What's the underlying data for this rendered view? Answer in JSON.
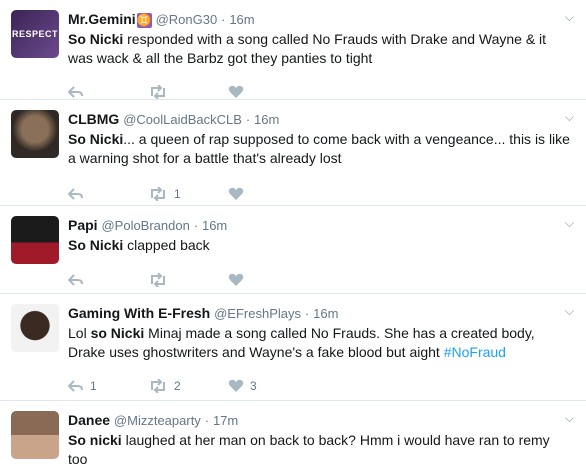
{
  "tweets": [
    {
      "name": "Mr.Gemini",
      "badge": "♊",
      "handle": "@RonG30",
      "time": "16m",
      "avatar_text": "RESPECT",
      "avatar_colors": [
        "#3a2455",
        "#6c4a8e"
      ],
      "text_bold": "So Nicki",
      "text_rest": " responded with a song called No Frauds with Drake and Wayne & it was wack & all the Barbz got they panties to tight",
      "hashtag": "",
      "reply_count": "",
      "retweet_count": "",
      "like_count": ""
    },
    {
      "name": "CLBMG",
      "badge": "",
      "handle": "@CoolLaidBackCLB",
      "time": "16m",
      "avatar_text": "",
      "avatar_colors": [
        "#6b5a47",
        "#2f2a25"
      ],
      "text_bold": "So Nicki",
      "text_rest": "... a queen of rap supposed to come back with a vengeance... this is like a warning shot for a battle that's already lost",
      "hashtag": "",
      "reply_count": "",
      "retweet_count": "1",
      "like_count": ""
    },
    {
      "name": "Papi",
      "badge": "",
      "handle": "@PoloBrandon",
      "time": "16m",
      "avatar_text": "",
      "avatar_colors": [
        "#1b1b1b",
        "#a01a2a"
      ],
      "text_bold": "So Nicki",
      "text_rest": " clapped back",
      "hashtag": "",
      "reply_count": "",
      "retweet_count": "",
      "like_count": ""
    },
    {
      "name": "Gaming With E-Fresh",
      "badge": "",
      "handle": "@EFreshPlays",
      "time": "16m",
      "avatar_text": "",
      "avatar_colors": [
        "#f2f2f2",
        "#3b2a22"
      ],
      "text_pre": "Lol ",
      "text_bold": "so Nicki",
      "text_rest": " Minaj made a song called No Frauds. She has a created body, Drake uses ghostwriters and Wayne's a fake blood but aight ",
      "hashtag": "#NoFraud",
      "reply_count": "1",
      "retweet_count": "2",
      "like_count": "3"
    },
    {
      "name": "Danee",
      "badge": "",
      "handle": "@Mizzteaparty",
      "time": "17m",
      "avatar_text": "",
      "avatar_colors": [
        "#8a6a55",
        "#c9a48a"
      ],
      "text_bold": "So nicki",
      "text_rest": " laughed at her man on back to back? Hmm i would have ran to remy too",
      "hashtag": "",
      "reply_count": "",
      "retweet_count": "",
      "like_count": ""
    }
  ],
  "separator": "·",
  "caret_icon": "chevron-down-icon",
  "colors": {
    "hashtag": "#1da1f2",
    "muted": "#657786",
    "icon": "#aab8c2"
  }
}
